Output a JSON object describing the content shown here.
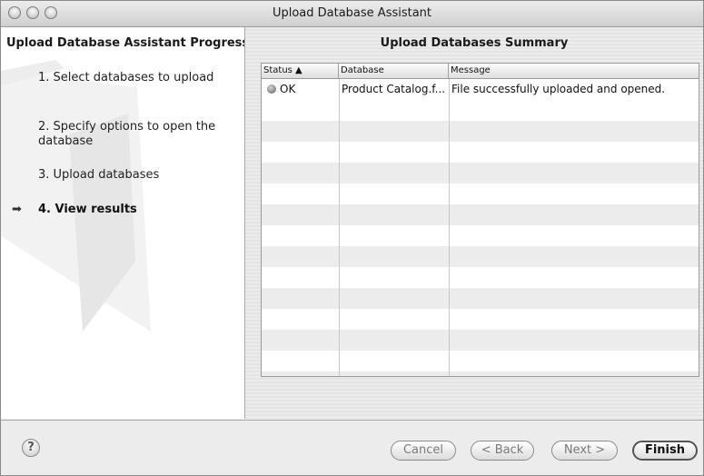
{
  "window": {
    "title": "Upload Database Assistant"
  },
  "progress": {
    "title": "Upload Database Assistant Progress",
    "steps": [
      {
        "label": "1. Select databases to upload"
      },
      {
        "label": "2. Specify options to open the database"
      },
      {
        "label": "3. Upload databases"
      },
      {
        "label": "4. View results"
      }
    ],
    "current_step_marker": "➡"
  },
  "summary": {
    "title": "Upload Databases Summary",
    "columns": [
      "Status ▲",
      "Database",
      "Message"
    ],
    "rows": [
      {
        "status": "OK",
        "database": "Product Catalog.f...",
        "message": "File successfully uploaded and opened."
      }
    ]
  },
  "buttons": {
    "help": "?",
    "cancel": "Cancel",
    "back": "< Back",
    "next": "Next >",
    "finish": "Finish"
  },
  "icons": {
    "status_ok": "gray-dot-icon",
    "help": "question-mark-icon",
    "current_step": "arrow-right-icon"
  }
}
